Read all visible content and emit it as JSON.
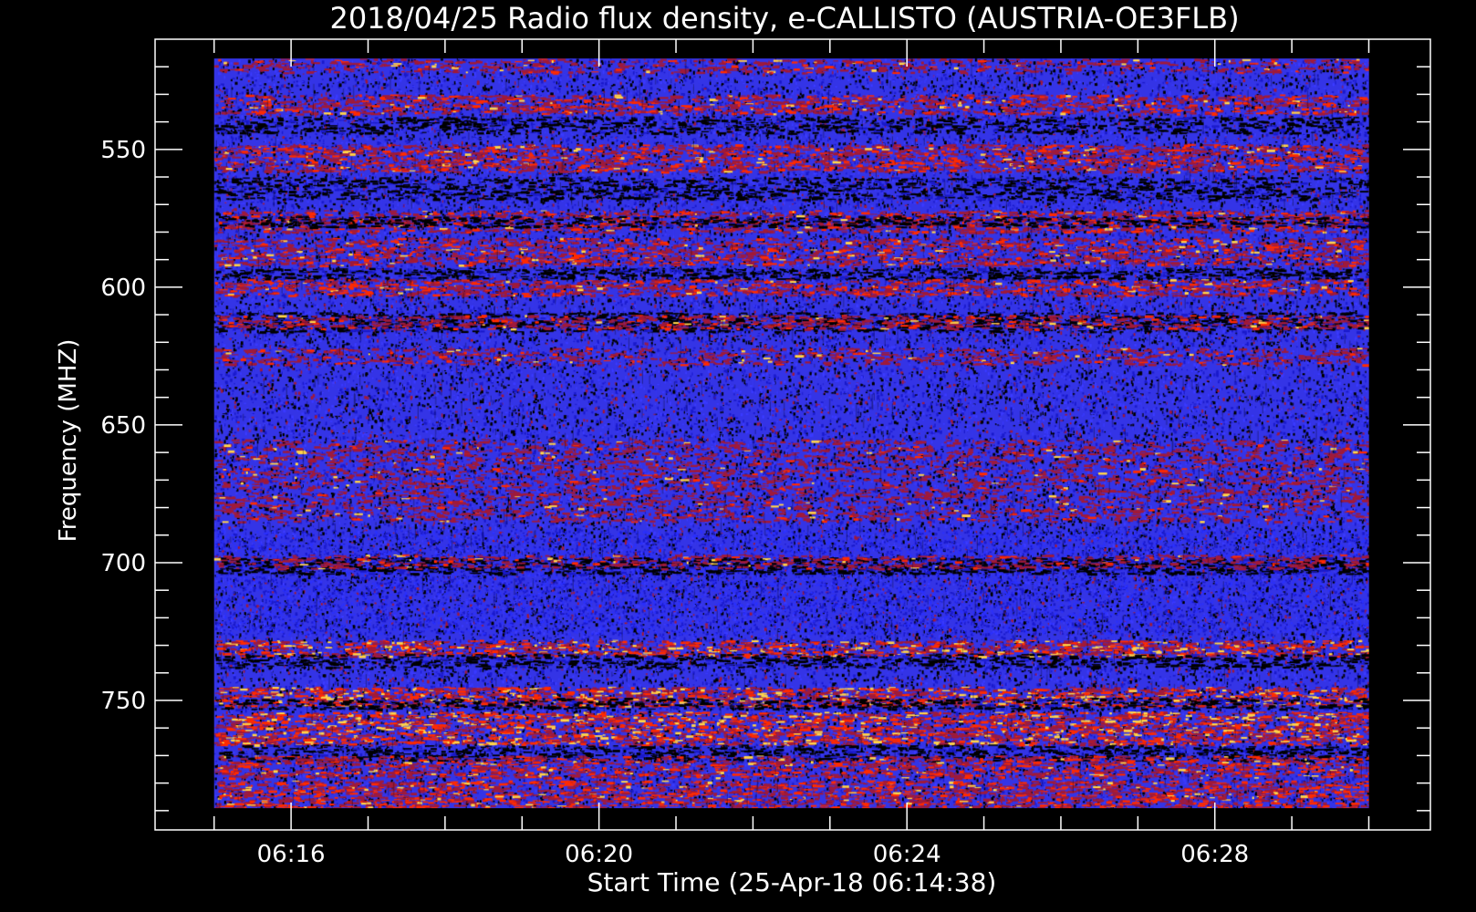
{
  "chart_data": {
    "type": "heatmap",
    "title": "2018/04/25  Radio flux density, e-CALLISTO (AUSTRIA-OE3FLB)",
    "xlabel": "Start Time (25-Apr-18 06:14:38)",
    "ylabel": "Frequency (MHZ)",
    "x_unit": "time of day",
    "xlim": [
      "06:14:14",
      "06:30:48"
    ],
    "data_x_range": [
      "06:15:00",
      "06:30:00"
    ],
    "x_ticks": [
      "06:16",
      "06:20",
      "06:24",
      "06:28"
    ],
    "ylim": [
      510,
      797
    ],
    "data_y_range": [
      517,
      789
    ],
    "y_inverted": true,
    "y_ticks": [
      550,
      600,
      650,
      700,
      750
    ],
    "colormap": [
      "#000000",
      "#1a1acc",
      "#3a3aff",
      "#a01a3a",
      "#ff2a00",
      "#ffd24a"
    ],
    "background": "#3434e6",
    "bands": [
      {
        "f0": 517,
        "f1": 522,
        "kind": "bright",
        "intensity": 0.25
      },
      {
        "f0": 530,
        "f1": 537,
        "kind": "bright",
        "intensity": 0.55
      },
      {
        "f0": 538,
        "f1": 544,
        "kind": "dark",
        "intensity": 0.45
      },
      {
        "f0": 548,
        "f1": 558,
        "kind": "bright",
        "intensity": 0.6
      },
      {
        "f0": 560,
        "f1": 568,
        "kind": "dark",
        "intensity": 0.4
      },
      {
        "f0": 572,
        "f1": 580,
        "kind": "bright",
        "intensity": 0.55
      },
      {
        "f0": 574,
        "f1": 578,
        "kind": "dark",
        "intensity": 0.6
      },
      {
        "f0": 582,
        "f1": 592,
        "kind": "bright",
        "intensity": 0.5
      },
      {
        "f0": 593,
        "f1": 597,
        "kind": "dark",
        "intensity": 0.6
      },
      {
        "f0": 597,
        "f1": 603,
        "kind": "bright",
        "intensity": 0.6
      },
      {
        "f0": 609,
        "f1": 616,
        "kind": "dark",
        "intensity": 0.6
      },
      {
        "f0": 610,
        "f1": 615,
        "kind": "bright",
        "intensity": 0.45
      },
      {
        "f0": 622,
        "f1": 628,
        "kind": "bright",
        "intensity": 0.25
      },
      {
        "f0": 655,
        "f1": 685,
        "kind": "bright",
        "intensity": 0.15
      },
      {
        "f0": 698,
        "f1": 704,
        "kind": "dark",
        "intensity": 0.8
      },
      {
        "f0": 697,
        "f1": 702,
        "kind": "bright",
        "intensity": 0.3
      },
      {
        "f0": 728,
        "f1": 734,
        "kind": "bright",
        "intensity": 0.75
      },
      {
        "f0": 733,
        "f1": 738,
        "kind": "dark",
        "intensity": 0.6
      },
      {
        "f0": 745,
        "f1": 752,
        "kind": "bright",
        "intensity": 0.85
      },
      {
        "f0": 749,
        "f1": 753,
        "kind": "dark",
        "intensity": 0.5
      },
      {
        "f0": 754,
        "f1": 766,
        "kind": "bright",
        "intensity": 0.85
      },
      {
        "f0": 766,
        "f1": 772,
        "kind": "dark",
        "intensity": 0.45
      },
      {
        "f0": 770,
        "f1": 778,
        "kind": "bright",
        "intensity": 0.6
      },
      {
        "f0": 779,
        "f1": 789,
        "kind": "bright",
        "intensity": 0.7
      }
    ]
  }
}
